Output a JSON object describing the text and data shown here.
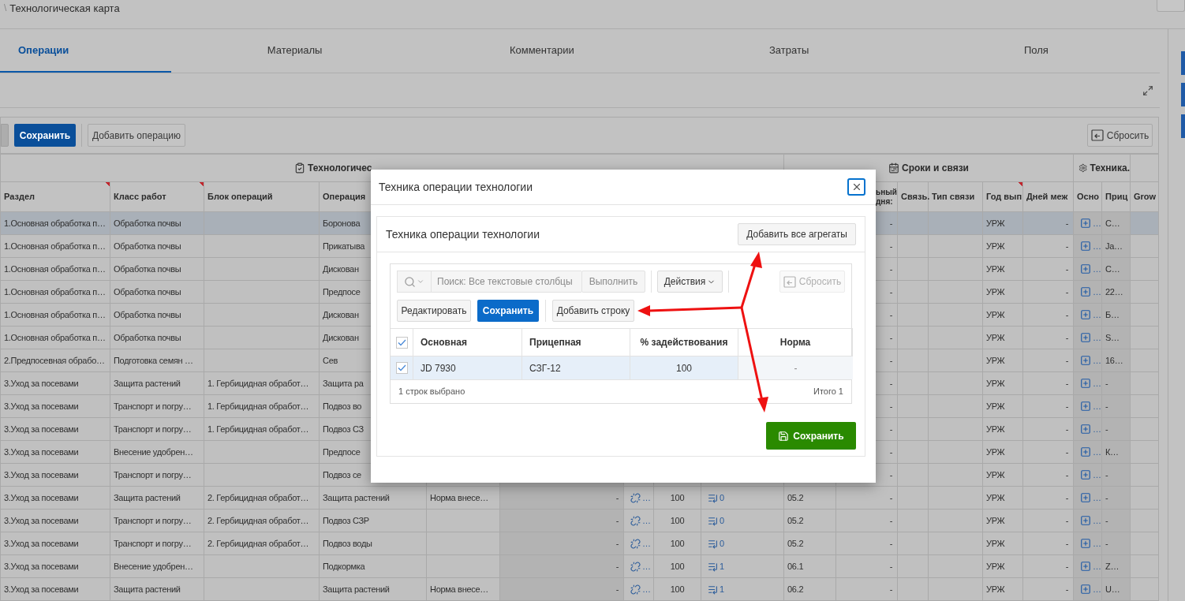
{
  "breadcrumb": {
    "separator": "\\",
    "title": "Технологическая карта"
  },
  "tabs": [
    {
      "label": "Операции",
      "selected": true
    },
    {
      "label": "Материалы",
      "selected": false
    },
    {
      "label": "Комментарии",
      "selected": false
    },
    {
      "label": "Затраты",
      "selected": false
    },
    {
      "label": "Поля",
      "selected": false
    }
  ],
  "toolbar": {
    "save_button": "Сохранить",
    "add_button": "Добавить операцию",
    "reset_button": "Сбросить"
  },
  "table": {
    "groups": [
      {
        "label": "Технологичес",
        "kind": "tech"
      },
      {
        "label": "Сроки и связи",
        "kind": "timing"
      },
      {
        "label": "Техника.",
        "kind": "machinery"
      }
    ],
    "columns_left": [
      {
        "label": "Раздел",
        "required": true
      },
      {
        "label": "Класс работ",
        "required": true
      },
      {
        "label": "Блок операций",
        "required": false
      },
      {
        "label": "Операция"
      }
    ],
    "columns_right": [
      {
        "label": "ьный дня:",
        "required": false
      },
      {
        "label": "Связь.",
        "required": false
      },
      {
        "label": "Тип связи",
        "required": false
      },
      {
        "label": "Год вып",
        "required": true
      },
      {
        "label": "Дней меж",
        "required": false
      },
      {
        "label": "Осно",
        "required": false
      },
      {
        "label": "Приц",
        "required": false
      },
      {
        "label": "Grow",
        "required": false
      }
    ],
    "rows": [
      {
        "selected": true,
        "section": "1.Основная обработка п…",
        "work_class": "Обработка почвы",
        "operation": "Боронова",
        "column_11": "-",
        "year": "УРЖ",
        "days": "-",
        "main": "…",
        "trailer": "С…"
      },
      {
        "selected": false,
        "section": "1.Основная обработка п…",
        "work_class": "Обработка почвы",
        "operation": "Прикатыва",
        "column_11": "-",
        "year": "УРЖ",
        "days": "-",
        "main": "…",
        "trailer": "Ja…"
      },
      {
        "selected": false,
        "section": "1.Основная обработка п…",
        "work_class": "Обработка почвы",
        "operation": "Дискован",
        "column_11": "-",
        "year": "УРЖ",
        "days": "-",
        "main": "…",
        "trailer": "С…"
      },
      {
        "selected": false,
        "section": "1.Основная обработка п…",
        "work_class": "Обработка почвы",
        "operation": "Предпосе",
        "column_11": "-",
        "year": "УРЖ",
        "days": "-",
        "main": "…",
        "trailer": "22…"
      },
      {
        "selected": false,
        "section": "1.Основная обработка п…",
        "work_class": "Обработка почвы",
        "operation": "Дискован",
        "column_11": "-",
        "year": "УРЖ",
        "days": "-",
        "main": "…",
        "trailer": "Б…"
      },
      {
        "selected": false,
        "section": "1.Основная обработка п…",
        "work_class": "Обработка почвы",
        "operation": "Дискован",
        "column_11": "-",
        "year": "УРЖ",
        "days": "-",
        "main": "…",
        "trailer": "S…"
      },
      {
        "selected": false,
        "section": "2.Предпосевная обрабо…",
        "work_class": "Подготовка семян …",
        "operation": "Сев",
        "column_11": "-",
        "year": "УРЖ",
        "days": "-",
        "main": "…",
        "trailer": "16…"
      },
      {
        "selected": false,
        "section": "3.Уход за посевами",
        "work_class": "Защита растений",
        "operation_block": "1. Гербицидная обработ…",
        "operation": "Защита ра",
        "column_11": "-",
        "year": "УРЖ",
        "days": "-",
        "main": "…",
        "trailer": "-"
      },
      {
        "selected": false,
        "section": "3.Уход за посевами",
        "work_class": "Транспорт и погру…",
        "operation_block": "1. Гербицидная обработ…",
        "operation": "Подвоз во",
        "column_11": "-",
        "year": "УРЖ",
        "days": "-",
        "main": "…",
        "trailer": "-"
      },
      {
        "selected": false,
        "section": "3.Уход за посевами",
        "work_class": "Транспорт и погру…",
        "operation_block": "1. Гербицидная обработ…",
        "operation": "Подвоз СЗ",
        "column_11": "-",
        "year": "УРЖ",
        "days": "-",
        "main": "…",
        "trailer": "-"
      },
      {
        "selected": false,
        "section": "3.Уход за посевами",
        "work_class": "Внесение удобрен…",
        "operation": "Предпосе",
        "column_11": "-",
        "year": "УРЖ",
        "days": "-",
        "main": "…",
        "trailer": "К…"
      },
      {
        "selected": false,
        "section": "3.Уход за посевами",
        "work_class": "Транспорт и погру…",
        "operation": "Подвоз се",
        "column_11": "-",
        "year": "УРЖ",
        "days": "-",
        "main": "…",
        "trailer": "-"
      },
      {
        "selected": false,
        "section": "3.Уход за посевами",
        "work_class": "Защита растений",
        "operation_block": "2. Гербицидная обработ…",
        "operation": "Защита растений",
        "column_5": "Норма внесе…",
        "column_6": "-",
        "column_7": "…",
        "column_8": "100",
        "column_9": "0",
        "column_10": "05.2",
        "column_11": "-",
        "year": "УРЖ",
        "days": "-",
        "main": "…",
        "trailer": "-"
      },
      {
        "selected": false,
        "section": "3.Уход за посевами",
        "work_class": "Транспорт и погру…",
        "operation_block": "2. Гербицидная обработ…",
        "operation": "Подвоз СЗР",
        "column_6": "-",
        "column_7": "…",
        "column_8": "100",
        "column_9": "0",
        "column_10": "05.2",
        "column_11": "-",
        "year": "УРЖ",
        "days": "-",
        "main": "…",
        "trailer": "-"
      },
      {
        "selected": false,
        "section": "3.Уход за посевами",
        "work_class": "Транспорт и погру…",
        "operation_block": "2. Гербицидная обработ…",
        "operation": "Подвоз воды",
        "column_6": "-",
        "column_7": "…",
        "column_8": "100",
        "column_9": "0",
        "column_10": "05.2",
        "column_11": "-",
        "year": "УРЖ",
        "days": "-",
        "main": "…",
        "trailer": "-"
      },
      {
        "selected": false,
        "section": "3.Уход за посевами",
        "work_class": "Внесение удобрен…",
        "operation": "Подкормка",
        "column_6": "-",
        "column_7": "…",
        "column_8": "100",
        "column_9": "1",
        "column_10": "06.1",
        "column_11": "-",
        "year": "УРЖ",
        "days": "-",
        "main": "…",
        "trailer": "Z…"
      },
      {
        "selected": false,
        "section": "3.Уход за посевами",
        "work_class": "Защита растений",
        "operation": "Защита растений",
        "column_5": "Норма внесе…",
        "column_6": "-",
        "column_7": "…",
        "column_8": "100",
        "column_9": "1",
        "column_10": "06.2",
        "column_11": "-",
        "year": "УРЖ",
        "days": "-",
        "main": "…",
        "trailer": "U…"
      }
    ]
  },
  "dialog": {
    "title": "Техника операции технологии",
    "region_title": "Техника операции технологии",
    "add_all_button": "Добавить все агрегаты",
    "search": {
      "placeholder": "Поиск: Все текстовые столбцы"
    },
    "go_button": "Выполнить",
    "actions_button": "Действия",
    "reset_button": {
      "label": "Сбросить",
      "disabled": true
    },
    "edit_button": "Редактировать",
    "save_button": "Сохранить",
    "add_row_button": "Добавить строку",
    "grid": {
      "select_all_checked": true,
      "columns": [
        "Основная",
        "Прицепная",
        "% задействования",
        "Норма"
      ],
      "rows": [
        {
          "checked": true,
          "selected": true,
          "main": "JD 7930",
          "trailer": "СЗГ-12",
          "share": "100",
          "rate": "-"
        }
      ],
      "selected_count": "1 строк выбрано",
      "total": "Итого 1"
    },
    "submit_button": "Сохранить"
  }
}
